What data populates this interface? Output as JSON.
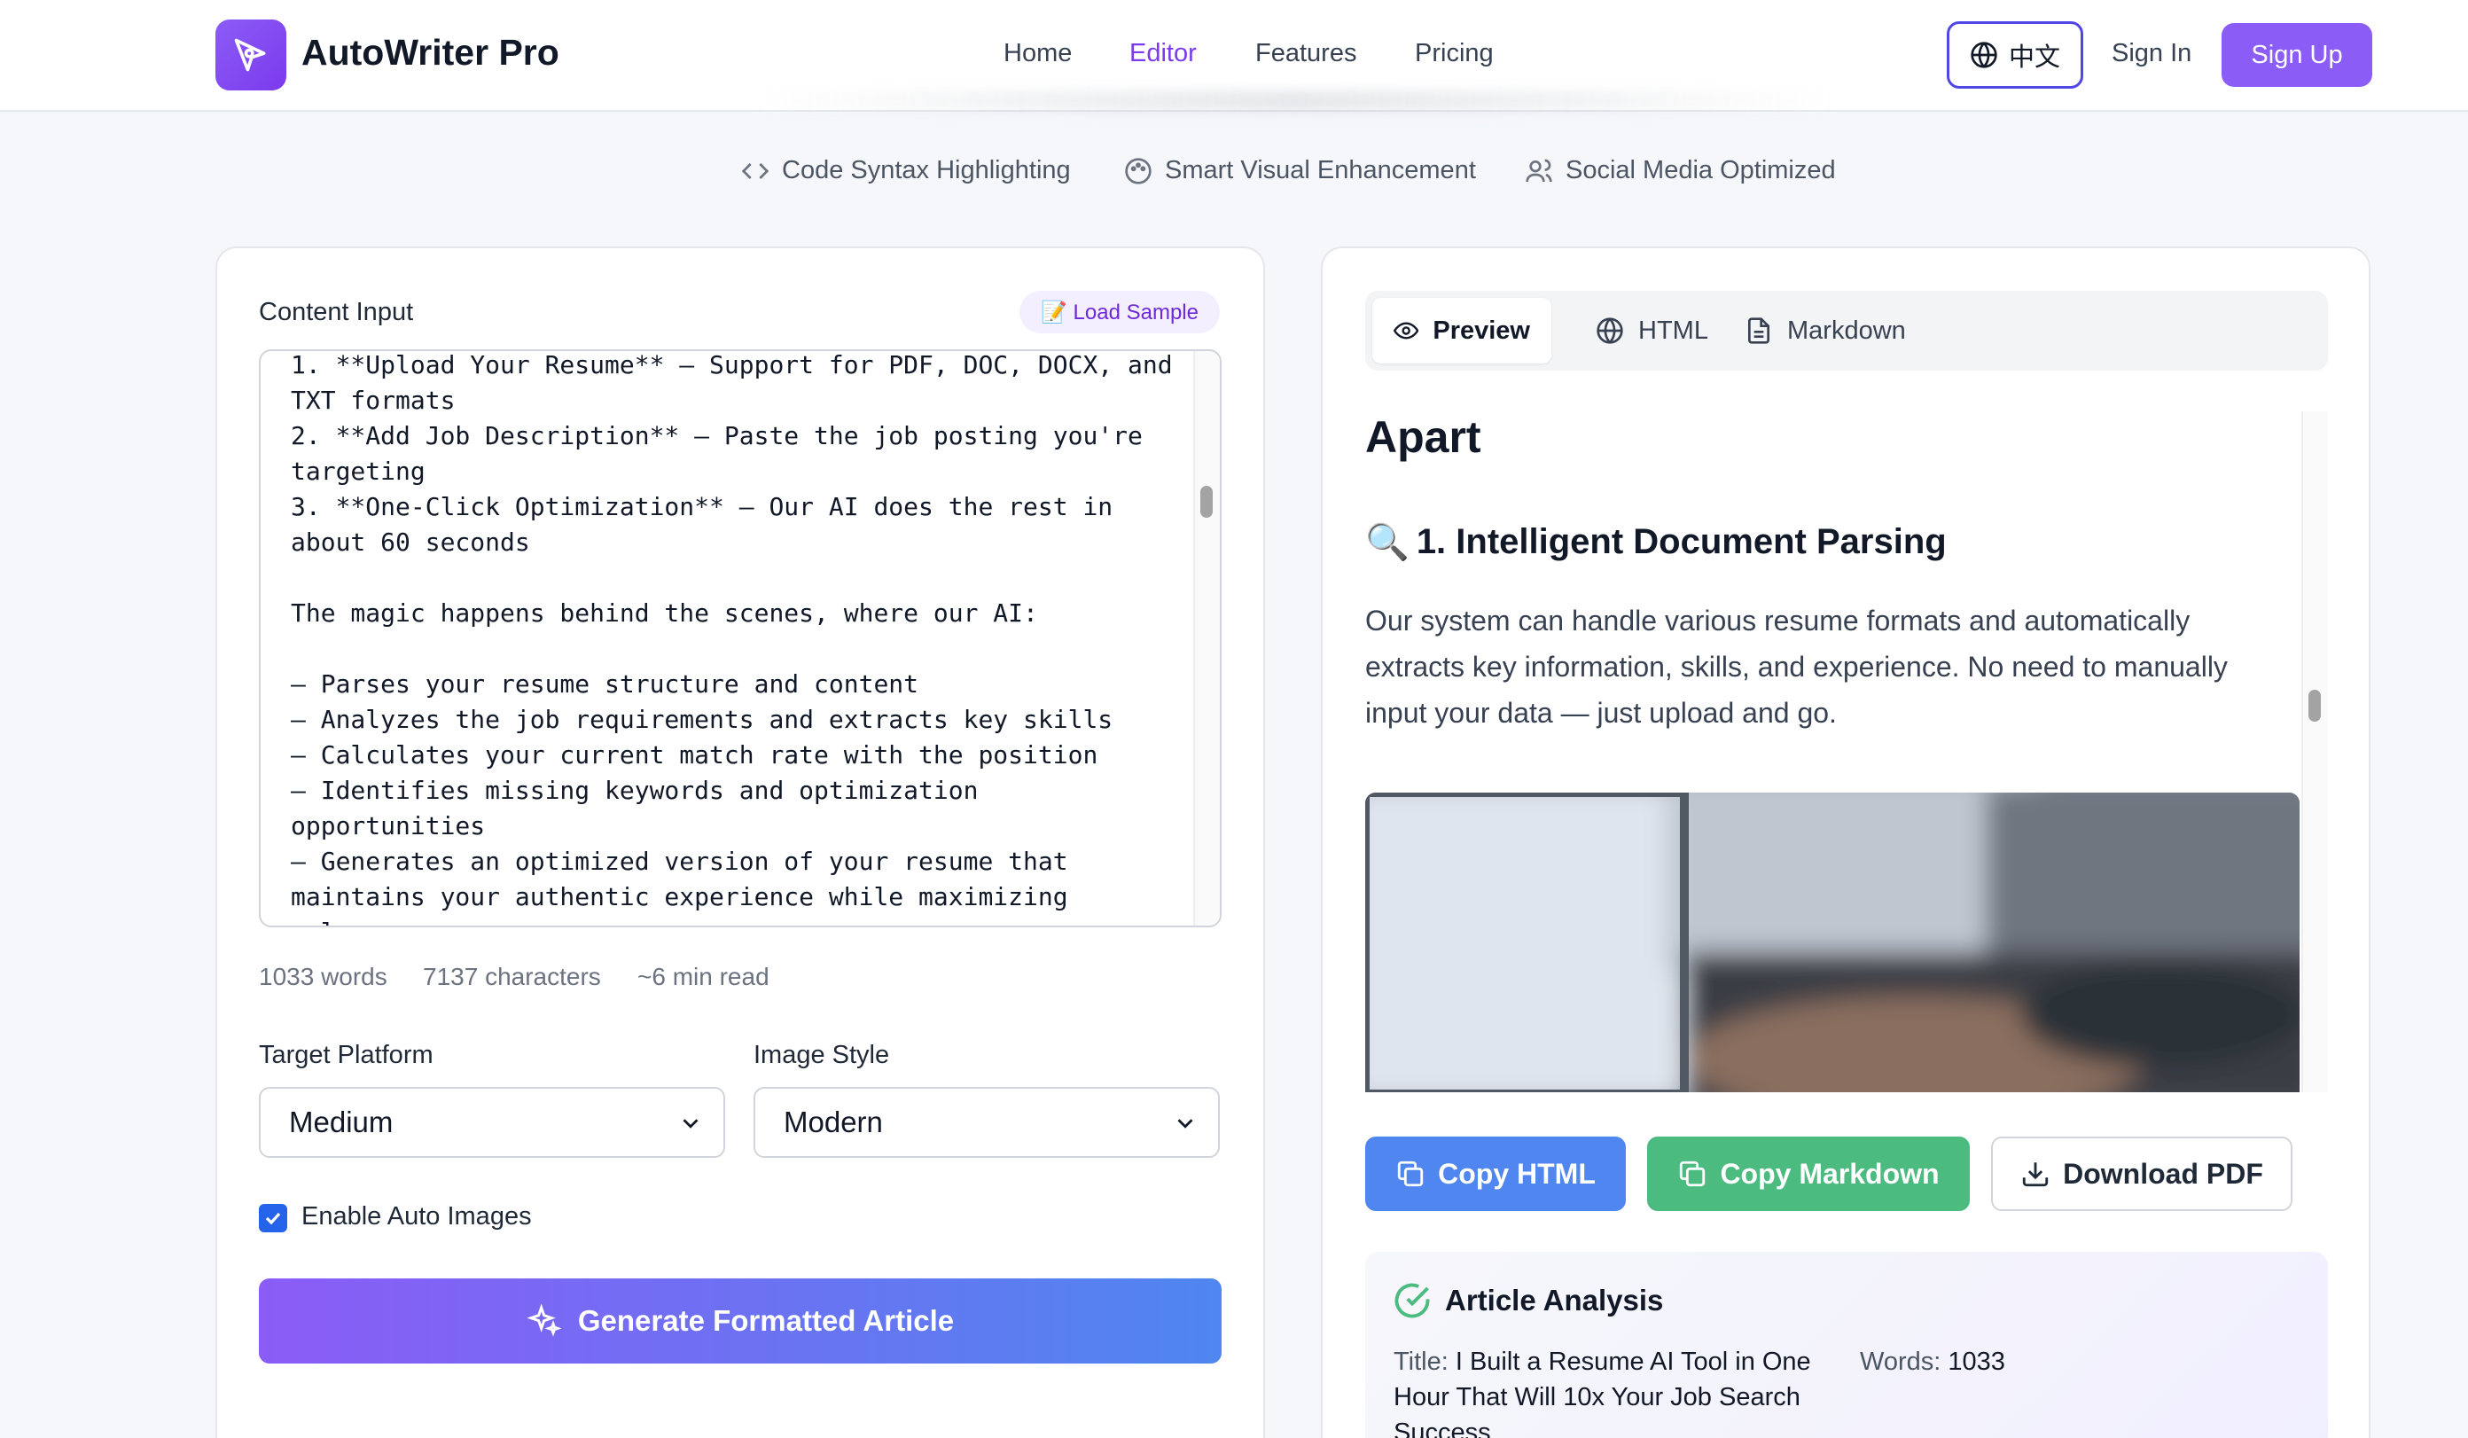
{
  "header": {
    "app_name": "AutoWriter Pro",
    "nav": [
      "Home",
      "Editor",
      "Features",
      "Pricing"
    ],
    "active_nav": "Editor",
    "language_label": "中文",
    "sign_in_label": "Sign In",
    "sign_up_label": "Sign Up"
  },
  "features": [
    "Code Syntax Highlighting",
    "Smart Visual Enhancement",
    "Social Media Optimized"
  ],
  "input": {
    "section_label": "Content Input",
    "load_sample_label": "📝 Load Sample",
    "content": "1. **Upload Your Resume** – Support for PDF, DOC, DOCX, and TXT formats\n2. **Add Job Description** – Paste the job posting you're targeting\n3. **One-Click Optimization** – Our AI does the rest in about 60 seconds\n\nThe magic happens behind the scenes, where our AI:\n\n– Parses your resume structure and content\n– Analyzes the job requirements and extracts key skills\n– Calculates your current match rate with the position\n– Identifies missing keywords and optimization opportunities\n– Generates an optimized version of your resume that maintains your authentic experience while maximizing relevance",
    "word_count": "1033 words",
    "char_count": "7137 characters",
    "read_time": "~6 min read"
  },
  "options": {
    "platform_label": "Target Platform",
    "platform_value": "Medium",
    "image_style_label": "Image Style",
    "image_style_value": "Modern",
    "auto_images_label": "Enable Auto Images",
    "auto_images_checked": true,
    "generate_label": "Generate Formatted Article"
  },
  "output": {
    "tabs": [
      "Preview",
      "HTML",
      "Markdown"
    ],
    "active_tab": "Preview",
    "preview": {
      "heading": "Apart",
      "subheading_emoji": "🔍",
      "subheading": "1. Intelligent Document Parsing",
      "paragraph": "Our system can handle various resume formats and automatically extracts key information, skills, and experience. No need to manually input your data — just upload and go."
    },
    "copy_html_label": "Copy HTML",
    "copy_markdown_label": "Copy Markdown",
    "download_pdf_label": "Download PDF"
  },
  "analysis": {
    "title": "Article Analysis",
    "title_key": "Title:",
    "title_value": "I Built a Resume AI Tool in One Hour That Will 10x Your Job Search Success",
    "words_key": "Words:",
    "words_value": "1033"
  },
  "colors": {
    "brand": "#8b5cf6",
    "primary_blue": "#4f86ef",
    "success_green": "#4cbb7f"
  }
}
